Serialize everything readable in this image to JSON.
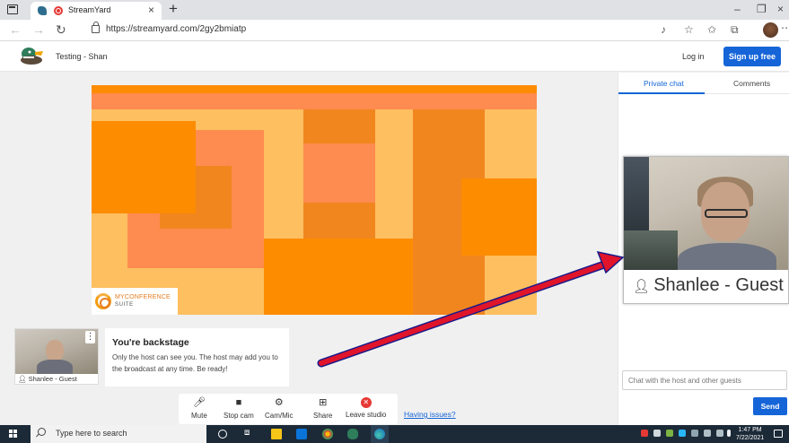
{
  "browser": {
    "tab_title": "StreamYard",
    "tab_close": "×",
    "new_tab": "+",
    "url": "https://streamyard.com/2gy2bmiatp",
    "win_min": "–",
    "win_max": "❐",
    "win_close": "×"
  },
  "header": {
    "studio_title": "Testing - Shan",
    "login_label": "Log in",
    "signup_label": "Sign up free"
  },
  "stage": {
    "brand_line1": "MYCONFERENCE",
    "brand_line2": "SUITE"
  },
  "self_view": {
    "name": "Shanlee - Guest",
    "menu": "⋮"
  },
  "backstage": {
    "title": "You're backstage",
    "message": "Only the host can see you. The host may add you to the broadcast at any time. Be ready!"
  },
  "controls": [
    {
      "label": "Mute"
    },
    {
      "label": "Stop cam"
    },
    {
      "label": "Cam/Mic"
    },
    {
      "label": "Share"
    },
    {
      "label": "Leave studio"
    }
  ],
  "having_issues": "Having issues?",
  "chat": {
    "tab_private": "Private chat",
    "tab_comments": "Comments",
    "input_placeholder": "Chat with the host and other guests",
    "send_label": "Send"
  },
  "zoom": {
    "name": "Shanlee - Guest"
  },
  "taskbar": {
    "search_placeholder": "Type here to search",
    "time": "1:47 PM",
    "date": "7/22/2021"
  },
  "colors": {
    "accent_blue": "#1565d8",
    "stage_orange": "#fd8c00",
    "leave_red": "#e53935",
    "arrow_red": "#e0142a"
  }
}
